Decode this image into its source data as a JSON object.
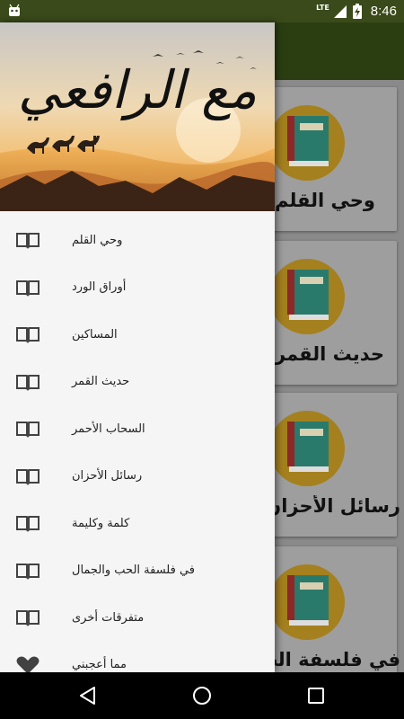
{
  "status_bar": {
    "time": "8:46",
    "network": "LTE",
    "icons": [
      "android-icon",
      "signal-icon",
      "battery-charging-icon"
    ]
  },
  "drawer": {
    "header_title": "مع الرافعي",
    "items": [
      {
        "label": "وحي القلم",
        "icon": "book-icon"
      },
      {
        "label": "أوراق الورد",
        "icon": "book-icon"
      },
      {
        "label": "المساكين",
        "icon": "book-icon"
      },
      {
        "label": "حديث القمر",
        "icon": "book-icon"
      },
      {
        "label": "السحاب الأحمر",
        "icon": "book-icon"
      },
      {
        "label": "رسائل الأحزان",
        "icon": "book-icon"
      },
      {
        "label": "كلمة وكليمة",
        "icon": "book-icon"
      },
      {
        "label": "في فلسفة الحب والجمال",
        "icon": "book-icon"
      },
      {
        "label": "متفرقات أخرى",
        "icon": "book-icon"
      },
      {
        "label": "مما أعجبني",
        "icon": "heart-icon"
      }
    ]
  },
  "cards": [
    {
      "title": "وحي القلم"
    },
    {
      "title": "حديث القمر"
    },
    {
      "title": "رسائل الأحزان"
    },
    {
      "title": "في فلسفة الحب"
    }
  ],
  "colors": {
    "status_bar": "#3a4a1a",
    "app_bar": "#2b3e12",
    "drawer_bg": "#f5f5f5",
    "book_icon": "#424242"
  },
  "nav": {
    "buttons": [
      "back-icon",
      "home-icon",
      "recents-icon"
    ]
  }
}
